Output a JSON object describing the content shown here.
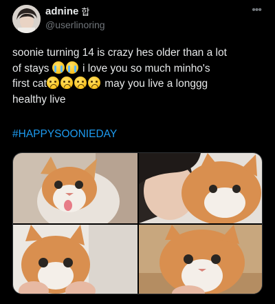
{
  "author": {
    "display_name": "adnine",
    "lock_icon": "lock-icon",
    "handle": "@userlinoring"
  },
  "menu": {
    "icon": "more-horizontal-icon",
    "glyph": "•••"
  },
  "tweet": {
    "line1": "soonie turning 14 is crazy hes older than a lot",
    "line2_start": "of stays",
    "line2_end": " i love you so much minho's",
    "line3_start": "first cat",
    "line3_end": " may you live a longgg",
    "line4": "healthy live",
    "hashtag": "#HAPPYSOONIEDAY"
  },
  "emojis": {
    "loudly_crying_face": "loudly-crying-face-emoji",
    "frowning_face": "frowning-face-emoji"
  },
  "media": {
    "photo_count": 4,
    "photos": [
      "cat-tongue-photo",
      "person-kissing-cat-photo",
      "cat-held-in-hands-photo",
      "cat-closeup-photo"
    ]
  },
  "colors": {
    "background": "#000000",
    "text": "#e7e9ea",
    "secondary": "#71767b",
    "link": "#1d9bf0"
  }
}
